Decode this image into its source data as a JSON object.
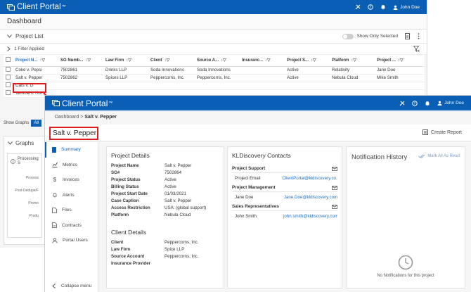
{
  "back": {
    "brand": "Client Portal",
    "user": "John Doe",
    "page_title": "Dashboard",
    "project_list_title": "Project List",
    "show_only_selected": "Show Only Selected",
    "filter_applied": "1 Filter Applied",
    "columns": [
      "Project N...",
      "SO Numb...",
      "Law Firm",
      "Client",
      "Source A...",
      "Insuranc...",
      "Project S...",
      "Platform",
      "Project ..."
    ],
    "rows": [
      [
        "Coke v. Pepsi",
        "7502861",
        "Drinks LLP",
        "Soda Innovations",
        "Soda Innovations",
        "",
        "Active",
        "Relativity",
        "Jane Doe"
      ],
      [
        "Salt v. Pepper",
        "7502862",
        "Spices LLP",
        "Peppercorns, Inc.",
        "Peppercorns, Inc.",
        "",
        "Active",
        "Nebula Cloud",
        "Mike Smith"
      ],
      [
        "Cats v. D",
        "",
        "",
        "",
        "",
        "",
        "",
        "",
        ""
      ],
      [
        "Vertical v. Hor",
        "",
        "",
        "",
        "",
        "",
        "",
        "",
        ""
      ]
    ],
    "show_graphs": "Show Graphs",
    "show_graphs_all": "All",
    "graphs_title": "Graphs",
    "processing_label": "Processing S",
    "graph_row_labels": [
      "Post-Dedupe/F",
      "Promo",
      "Produ"
    ],
    "graph_row_label_first": "Process"
  },
  "front": {
    "brand": "Client Portal",
    "user": "John Doe",
    "breadcrumb_root": "Dashboard",
    "breadcrumb_sep": ">",
    "breadcrumb_current": "Salt v. Pepper",
    "project_title": "Salt v. Pepper",
    "create_report": "Create Report",
    "nav": [
      "Summary",
      "Metrics",
      "Invoices",
      "Alerts",
      "Files",
      "Contracts",
      "Portal Users"
    ],
    "collapse_menu": "Collapse menu",
    "project_details": {
      "title": "Project Details",
      "fields": [
        {
          "k": "Project Name",
          "v": "Salt v. Pepper"
        },
        {
          "k": "SO#",
          "v": "7502864"
        },
        {
          "k": "Project Status",
          "v": "Active"
        },
        {
          "k": "Billing Status",
          "v": "Active"
        },
        {
          "k": "Project Start Date",
          "v": "01/03/2021"
        },
        {
          "k": "Case Caption",
          "v": "Salt v. Pepper"
        },
        {
          "k": "Access Restriction",
          "v": "USA: (global support)"
        },
        {
          "k": "Platform",
          "v": "Nebula Cloud"
        }
      ]
    },
    "client_details": {
      "title": "Client Details",
      "fields": [
        {
          "k": "Client",
          "v": "Peppercorns, Inc."
        },
        {
          "k": "Law Firm",
          "v": "Spice LLP"
        },
        {
          "k": "Source Account",
          "v": "Peppercorns, Inc."
        },
        {
          "k": "Insurance Provider",
          "v": ""
        }
      ]
    },
    "contacts": {
      "title": "KLDiscovery Contacts",
      "sections": [
        {
          "head": "Project Support",
          "name": "Project Email",
          "email": "ClientPortal@kldiscovery.co..."
        },
        {
          "head": "Project Management",
          "name": "Jane Doe",
          "email": "Jane.Doe@kldiscovery.com"
        },
        {
          "head": "Sales Representatives",
          "name": "John Smith",
          "email": "john.smith@kldiscovery.com"
        }
      ]
    },
    "notifications": {
      "title": "Notification History",
      "mark_all": "Mark All As Read",
      "empty": "No Notifications for this project"
    }
  },
  "colors": {
    "brand_blue": "#0a5fb4",
    "highlight_red": "#e01b1b",
    "link_blue": "#1a6fc9"
  }
}
